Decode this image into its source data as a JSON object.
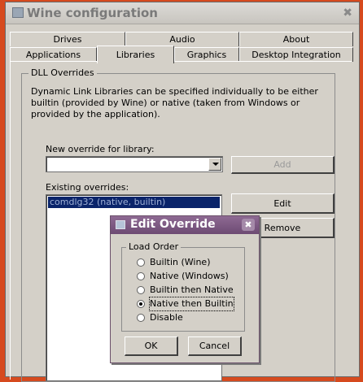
{
  "window": {
    "title": "Wine configuration",
    "close_glyph": "✖"
  },
  "tabs_top": [
    "Drives",
    "Audio",
    "About"
  ],
  "tabs_bottom": [
    "Applications",
    "Libraries",
    "Graphics",
    "Desktop Integration"
  ],
  "active_tab": "Libraries",
  "dll": {
    "group_label": "DLL Overrides",
    "description": "Dynamic Link Libraries can be specified individually to be either builtin (provided by Wine) or native (taken from Windows or provided by the application).",
    "new_override_label": "New override for library:",
    "new_override_value": "",
    "add_label": "Add",
    "existing_label": "Existing overrides:",
    "existing_items": [
      "comdlg32 (native, builtin)"
    ],
    "edit_label": "Edit",
    "remove_label": "Remove"
  },
  "dialog": {
    "title": "Edit Override",
    "close_glyph": "✖",
    "group_label": "Load Order",
    "options": [
      "Builtin (Wine)",
      "Native (Windows)",
      "Builtin then Native",
      "Native then Builtin",
      "Disable"
    ],
    "selected": "Native then Builtin",
    "ok_label": "OK",
    "cancel_label": "Cancel"
  }
}
